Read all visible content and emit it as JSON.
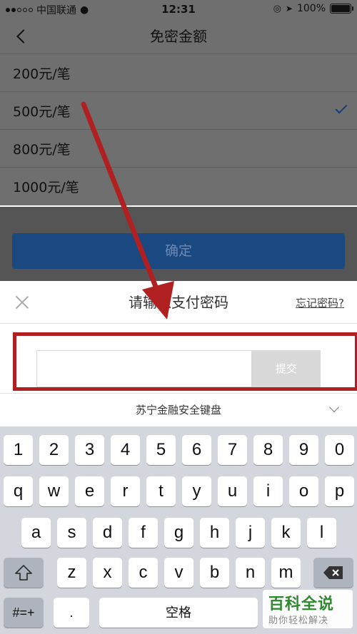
{
  "status_bar": {
    "carrier": "中国联通",
    "time": "12:31",
    "battery": "100%"
  },
  "nav": {
    "title": "免密金额"
  },
  "list": {
    "items": [
      {
        "label": "200元/笔",
        "selected": false
      },
      {
        "label": "500元/笔",
        "selected": true
      },
      {
        "label": "800元/笔",
        "selected": false
      },
      {
        "label": "1000元/笔",
        "selected": false
      }
    ]
  },
  "confirm_button": "确定",
  "dialog": {
    "title": "请输入支付密码",
    "forgot_link": "忘记密码?",
    "submit_label": "提交"
  },
  "keyboard": {
    "title": "苏宁金融安全键盘",
    "row1": [
      "1",
      "2",
      "3",
      "4",
      "5",
      "6",
      "7",
      "8",
      "9",
      "0"
    ],
    "row2": [
      "q",
      "w",
      "e",
      "r",
      "t",
      "y",
      "u",
      "i",
      "o",
      "p"
    ],
    "row3": [
      "a",
      "s",
      "d",
      "f",
      "g",
      "h",
      "j",
      "k",
      "l"
    ],
    "row4": [
      "z",
      "x",
      "c",
      "v",
      "b",
      "n",
      "m"
    ],
    "symbol_key": "#=+",
    "dot_key": ".",
    "space_key": "空格"
  },
  "watermark": {
    "title": "百科全说",
    "subtitle": "助你轻松解决"
  },
  "colors": {
    "overlay_dim": "#6f6f6f",
    "primary_blue": "#1a4880",
    "annotation_red": "#b02020",
    "keyboard_bg": "#d3d6dc"
  }
}
